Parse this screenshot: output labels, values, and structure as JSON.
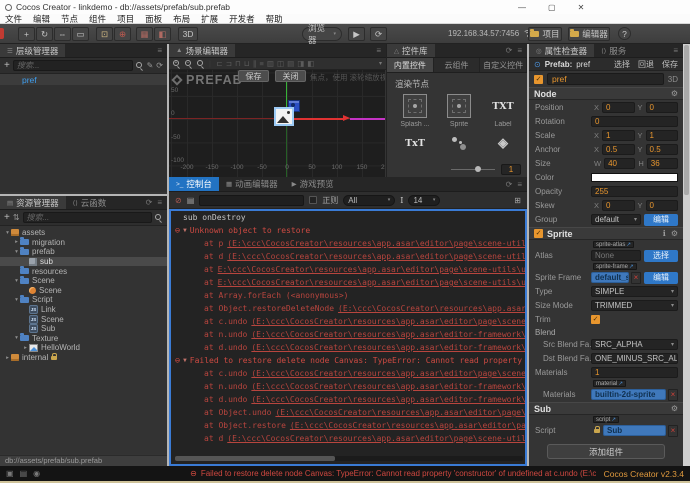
{
  "title_bar": {
    "title": "Cocos Creator - linkdemo - db://assets/prefab/sub.prefab"
  },
  "menu": {
    "items": [
      "文件",
      "编辑",
      "节点",
      "组件",
      "项目",
      "面板",
      "布局",
      "扩展",
      "开发者",
      "帮助"
    ]
  },
  "icons": {
    "minimize": "—",
    "maximize": "▢",
    "close": "✕",
    "menu": "≡",
    "refresh": "⟳",
    "play": "▶",
    "add": "+",
    "move": "+",
    "rotate": "↻",
    "scale": "⇔",
    "rect": "▭",
    "pivot": "⊡",
    "local": "⊕",
    "grid": "▦",
    "half": "◧",
    "help": "?",
    "terminal": ">_",
    "film": "▦",
    "preview": "▶",
    "clear": "⊘",
    "doc": "▤",
    "export": "⊞",
    "font": "I",
    "tree": "☰",
    "code": "⟨⟩",
    "inspector": "◎",
    "mountain": "▲",
    "gear": "⚙",
    "info": "ℹ",
    "check": "✓",
    "dropdown": "▾",
    "error": "⊖",
    "link": "⊙",
    "sort": "⇅",
    "pencil": "✎",
    "external": "↗",
    "status_1": "▣",
    "status_2": "▤",
    "status_3": "◉",
    "triangle": "△"
  },
  "toolbar": {
    "mode": "3D",
    "target": "浏览器",
    "address": "192.168.34.57:7456",
    "count": "2",
    "project": "项目",
    "editor": "编辑器",
    "corner": "C"
  },
  "hierarchy": {
    "tab": "层级管理器",
    "search_placeholder": "搜索...",
    "nodes": [
      {
        "label": "pref"
      }
    ]
  },
  "assets": {
    "tab": "资源管理器",
    "tab2": "云函数",
    "search_placeholder": "搜索...",
    "path": "db://assets/prefab/sub.prefab",
    "tree": [
      {
        "depth": 0,
        "arrow": "▾",
        "icon": "pkg",
        "label": "assets"
      },
      {
        "depth": 1,
        "arrow": "▸",
        "icon": "folder",
        "label": "migration"
      },
      {
        "depth": 1,
        "arrow": "▾",
        "icon": "folder",
        "label": "prefab"
      },
      {
        "depth": 2,
        "arrow": "",
        "icon": "prefab",
        "label": "sub",
        "selected": true
      },
      {
        "depth": 1,
        "arrow": "",
        "icon": "folder",
        "label": "resources"
      },
      {
        "depth": 1,
        "arrow": "▾",
        "icon": "folder",
        "label": "Scene"
      },
      {
        "depth": 2,
        "arrow": "",
        "icon": "scene",
        "label": "Scene"
      },
      {
        "depth": 1,
        "arrow": "▾",
        "icon": "folder",
        "label": "Script"
      },
      {
        "depth": 2,
        "arrow": "",
        "icon": "js",
        "label": "Link"
      },
      {
        "depth": 2,
        "arrow": "",
        "icon": "js",
        "label": "Scene"
      },
      {
        "depth": 2,
        "arrow": "",
        "icon": "js",
        "label": "Sub"
      },
      {
        "depth": 1,
        "arrow": "▾",
        "icon": "folder",
        "label": "Texture"
      },
      {
        "depth": 2,
        "arrow": "▸",
        "icon": "img",
        "label": "HelloWorld"
      },
      {
        "depth": 0,
        "arrow": "▸",
        "icon": "pkg",
        "label": "internal",
        "locked": true
      }
    ]
  },
  "scene": {
    "tab": "场景编辑器",
    "watermark": "PREFAB",
    "save": "保存",
    "close": "关闭",
    "hint": "焦点，使用 滚轮缩放视图",
    "ruler_x": [
      "-200",
      "-150",
      "-100",
      "-50",
      "0",
      "50",
      "100",
      "150",
      "2"
    ],
    "ruler_y": [
      "50",
      "0",
      "-50",
      "-100"
    ]
  },
  "library": {
    "tab": "控件库",
    "tabs": [
      "内置控件",
      "云组件",
      "自定义控件"
    ],
    "section": "渲染节点",
    "items": [
      {
        "icon": "sprite",
        "label": "Splash ..."
      },
      {
        "icon": "sprite",
        "label": "Sprite"
      },
      {
        "icon": "txt",
        "label": "Label",
        "glyph": "TXT"
      },
      {
        "icon": "txt",
        "label": "",
        "glyph": "TxT"
      },
      {
        "icon": "particle",
        "label": ""
      },
      {
        "icon": "tiled",
        "label": "",
        "glyph": "◈"
      }
    ],
    "zoom": "1"
  },
  "console": {
    "tabs": [
      {
        "icon": ">_",
        "label": "控制台",
        "active": true
      },
      {
        "icon": "▦",
        "label": "动画编辑器",
        "active": false
      },
      {
        "icon": "▶",
        "label": "游戏预览",
        "active": false
      }
    ],
    "filter": {
      "regex_label": "正则",
      "level": "All",
      "font_size": "14"
    },
    "lines": [
      {
        "t": "log",
        "text": "sub onDestroy"
      },
      {
        "t": "etitle",
        "text": "Unknown object to restore"
      },
      {
        "t": "stack",
        "fn": "p ",
        "link": "(E:\\ccc\\CocosCreator\\resources\\app.asar\\editor\\page\\scene-utils\\undo\\sc"
      },
      {
        "t": "stack",
        "fn": "d ",
        "link": "(E:\\ccc\\CocosCreator\\resources\\app.asar\\editor\\page\\scene-utils\\undo\\sc"
      },
      {
        "t": "stack",
        "fn": "",
        "link": "E:\\ccc\\CocosCreator\\resources\\app.asar\\editor\\page\\scene-utils\\undo\\scene"
      },
      {
        "t": "stack",
        "fn": "",
        "link": "E:\\ccc\\CocosCreator\\resources\\app.asar\\editor\\page\\scene-utils\\undo\\scene"
      },
      {
        "t": "stack",
        "fn": "Array.forEach (<anonymous>)",
        "link": ""
      },
      {
        "t": "stack",
        "fn": "Object.restoreDeleteNode ",
        "link": "(E:\\ccc\\CocosCreator\\resources\\app.asar\\editor\\p"
      },
      {
        "t": "stack",
        "fn": "c.undo ",
        "link": "(E:\\ccc\\CocosCreator\\resources\\app.asar\\editor\\page\\scene-utils\\un"
      },
      {
        "t": "stack",
        "fn": "n.undo ",
        "link": "(E:\\ccc\\CocosCreator\\resources\\app.asar\\editor-framework\\lib\\share"
      },
      {
        "t": "stack",
        "fn": "d.undo ",
        "link": "(E:\\ccc\\CocosCreator\\resources\\app.asar\\editor-framework\\lib\\share"
      },
      {
        "t": "etitle",
        "text": "Failed to restore delete node Canvas: TypeError: Cannot read property 'construct"
      },
      {
        "t": "stack",
        "fn": "c.undo ",
        "link": "(E:\\ccc\\CocosCreator\\resources\\app.asar\\editor\\page\\scene-utils\\un"
      },
      {
        "t": "stack",
        "fn": "n.undo ",
        "link": "(E:\\ccc\\CocosCreator\\resources\\app.asar\\editor-framework\\lib\\share"
      },
      {
        "t": "stack",
        "fn": "d.undo ",
        "link": "(E:\\ccc\\CocosCreator\\resources\\app.asar\\editor-framework\\lib\\share"
      },
      {
        "t": "stack",
        "fn": "Object.undo ",
        "link": "(E:\\ccc\\CocosCreator\\resources\\app.asar\\editor\\page\\scene-uti"
      },
      {
        "t": "stack",
        "fn": "Object.restore ",
        "link": "(E:\\ccc\\CocosCreator\\resources\\app.asar\\editor\\page\\scene-"
      },
      {
        "t": "stack",
        "fn": "d ",
        "link": "(E:\\ccc\\CocosCreator\\resources\\app.asar\\editor\\page\\scene-utils\\edit-mo"
      }
    ]
  },
  "inspector": {
    "tab": "属性检查器",
    "tab2": "服务",
    "prefab_bar": {
      "label": "Prefab:",
      "value": "pref",
      "actions": [
        "选择",
        "回退",
        "保存"
      ]
    },
    "name_row": {
      "value": "pref",
      "mode": "3D"
    },
    "sections": [
      {
        "title": "Node",
        "checkbox": false,
        "help": false,
        "rows": [
          {
            "t": "vec2",
            "label": "Position",
            "k1": "X",
            "v1": "0",
            "k2": "Y",
            "v2": "0"
          },
          {
            "t": "single",
            "label": "Rotation",
            "v": "0"
          },
          {
            "t": "vec2",
            "label": "Scale",
            "k1": "X",
            "v1": "1",
            "k2": "Y",
            "v2": "1"
          },
          {
            "t": "vec2",
            "label": "Anchor",
            "k1": "X",
            "v1": "0.5",
            "k2": "Y",
            "v2": "0.5"
          },
          {
            "t": "vec2",
            "label": "Size",
            "k1": "W",
            "v1": "40",
            "k2": "H",
            "v2": "36"
          },
          {
            "t": "color",
            "label": "Color",
            "v": "#ffffff"
          },
          {
            "t": "single",
            "label": "Opacity",
            "v": "255"
          },
          {
            "t": "vec2",
            "label": "Skew",
            "k1": "X",
            "v1": "0",
            "k2": "Y",
            "v2": "0"
          },
          {
            "t": "selectbtn",
            "label": "Group",
            "v": "default",
            "btn": "编辑"
          }
        ]
      },
      {
        "title": "Sprite",
        "checkbox": true,
        "help": true,
        "rows": [
          {
            "t": "asset",
            "label": "Atlas",
            "chip": "sprite-atlas",
            "v": "None",
            "vstyle": "none",
            "btn": "选择"
          },
          {
            "t": "asset",
            "label": "Sprite Frame",
            "chip": "sprite-frame",
            "v": "default_sprite",
            "vstyle": "ref",
            "btn": "编辑",
            "removable": true
          },
          {
            "t": "select",
            "label": "Type",
            "v": "SIMPLE"
          },
          {
            "t": "select",
            "label": "Size Mode",
            "v": "TRIMMED"
          },
          {
            "t": "check",
            "label": "Trim",
            "checked": true
          },
          {
            "t": "heading",
            "label": "Blend"
          },
          {
            "t": "select",
            "label": "Src Blend Fa...",
            "indent": true,
            "v": "SRC_ALPHA"
          },
          {
            "t": "select",
            "label": "Dst Blend Fa...",
            "indent": true,
            "v": "ONE_MINUS_SRC_ALPHA"
          },
          {
            "t": "single",
            "label": "Materials",
            "v": "1"
          },
          {
            "t": "asset",
            "label": "Materials",
            "indent": true,
            "chip": "material",
            "v": "builtin-2d-sprite",
            "vstyle": "ref",
            "removable": true
          }
        ]
      },
      {
        "title": "Sub",
        "checkbox": false,
        "help": false,
        "rows": [
          {
            "t": "asset",
            "label": "Script",
            "chip": "script",
            "v": "Sub",
            "vstyle": "ref",
            "removable": true,
            "lock": true
          }
        ]
      }
    ],
    "add_component": "添加组件"
  },
  "status_bar": {
    "error": "Failed to restore delete node Canvas: TypeError: Cannot read property 'constructor' of undefined at c.undo (E:\\ccc\\CocosCreator\\resources\\app.asar\\editor\\page\\scene-utils\\undo\\index.js:1:2611) at n.undo",
    "version": "Cocos Creator v2.3.4"
  }
}
